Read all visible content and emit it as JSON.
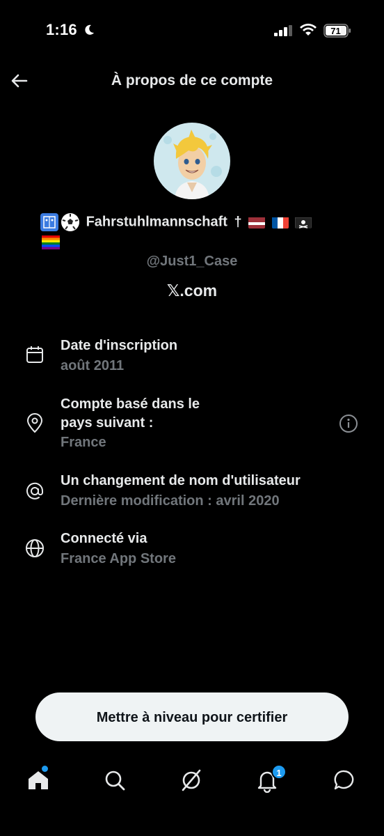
{
  "status_bar": {
    "time": "1:16",
    "battery": "71"
  },
  "header": {
    "title": "À propos de ce compte"
  },
  "profile": {
    "display_name": "Fahrstuhlmannschaft",
    "handle": "@Just1_Case",
    "site": "𝕏.com"
  },
  "details": [
    {
      "icon": "calendar-icon",
      "title": "Date d'inscription",
      "value": "août 2011"
    },
    {
      "icon": "location-pin-icon",
      "title_line1": "Compte basé dans le",
      "title_line2": "pays suivant :",
      "value": "France"
    },
    {
      "icon": "at-sign-icon",
      "title": "Un changement de nom d'utilisateur",
      "value": "Dernière modification : avril 2020"
    },
    {
      "icon": "globe-icon",
      "title": "Connecté via",
      "value": "France App Store"
    }
  ],
  "upgrade_button": {
    "label": "Mettre à niveau pour certifier"
  },
  "tabbar": {
    "notifications_count": "1"
  },
  "colors": {
    "background": "#000000",
    "primary_text": "#e7e9ea",
    "secondary_text": "#71767b",
    "accent": "#1d9bf0",
    "button_bg": "#eff3f4"
  }
}
